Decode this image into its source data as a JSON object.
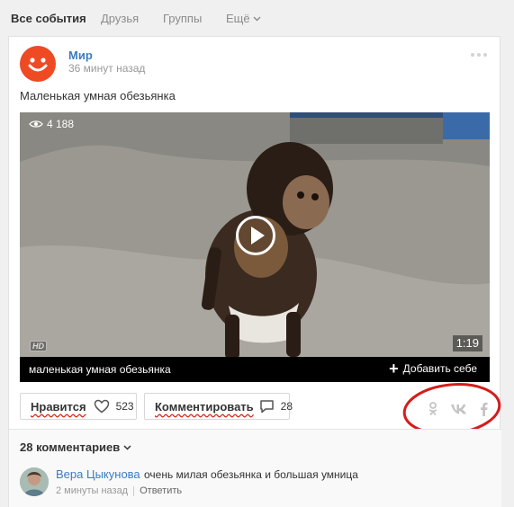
{
  "tabs": [
    {
      "label": "Все события"
    },
    {
      "label": "Друзья"
    },
    {
      "label": "Группы"
    },
    {
      "label": "Ещё"
    }
  ],
  "post": {
    "author": "Мир",
    "time": "36 минут назад",
    "text": "Маленькая умная обезьянка",
    "avatar_icon": "smiley-logo-icon",
    "avatar_color": "#ee4a23"
  },
  "video": {
    "views": "4 188",
    "duration": "1:19",
    "hd": "HD",
    "caption": "маленькая умная обезьянка",
    "add_label": "Добавить себе"
  },
  "actions": {
    "like_label": "Нравится",
    "like_count": "523",
    "comment_label": "Комментировать",
    "comment_count": "28"
  },
  "share": {
    "icons": [
      "odnoklassniki-icon",
      "vk-icon",
      "facebook-icon"
    ],
    "highlight_color": "#d61c1c"
  },
  "comments": {
    "toggle_label": "28 комментариев",
    "items": [
      {
        "author": "Вера Цыкунова",
        "text": "очень милая обезьянка и большая умница",
        "time": "2 минуты назад",
        "reply_label": "Ответить"
      }
    ]
  },
  "colors": {
    "link": "#3b7cbf",
    "accent": "#ee4a23"
  }
}
